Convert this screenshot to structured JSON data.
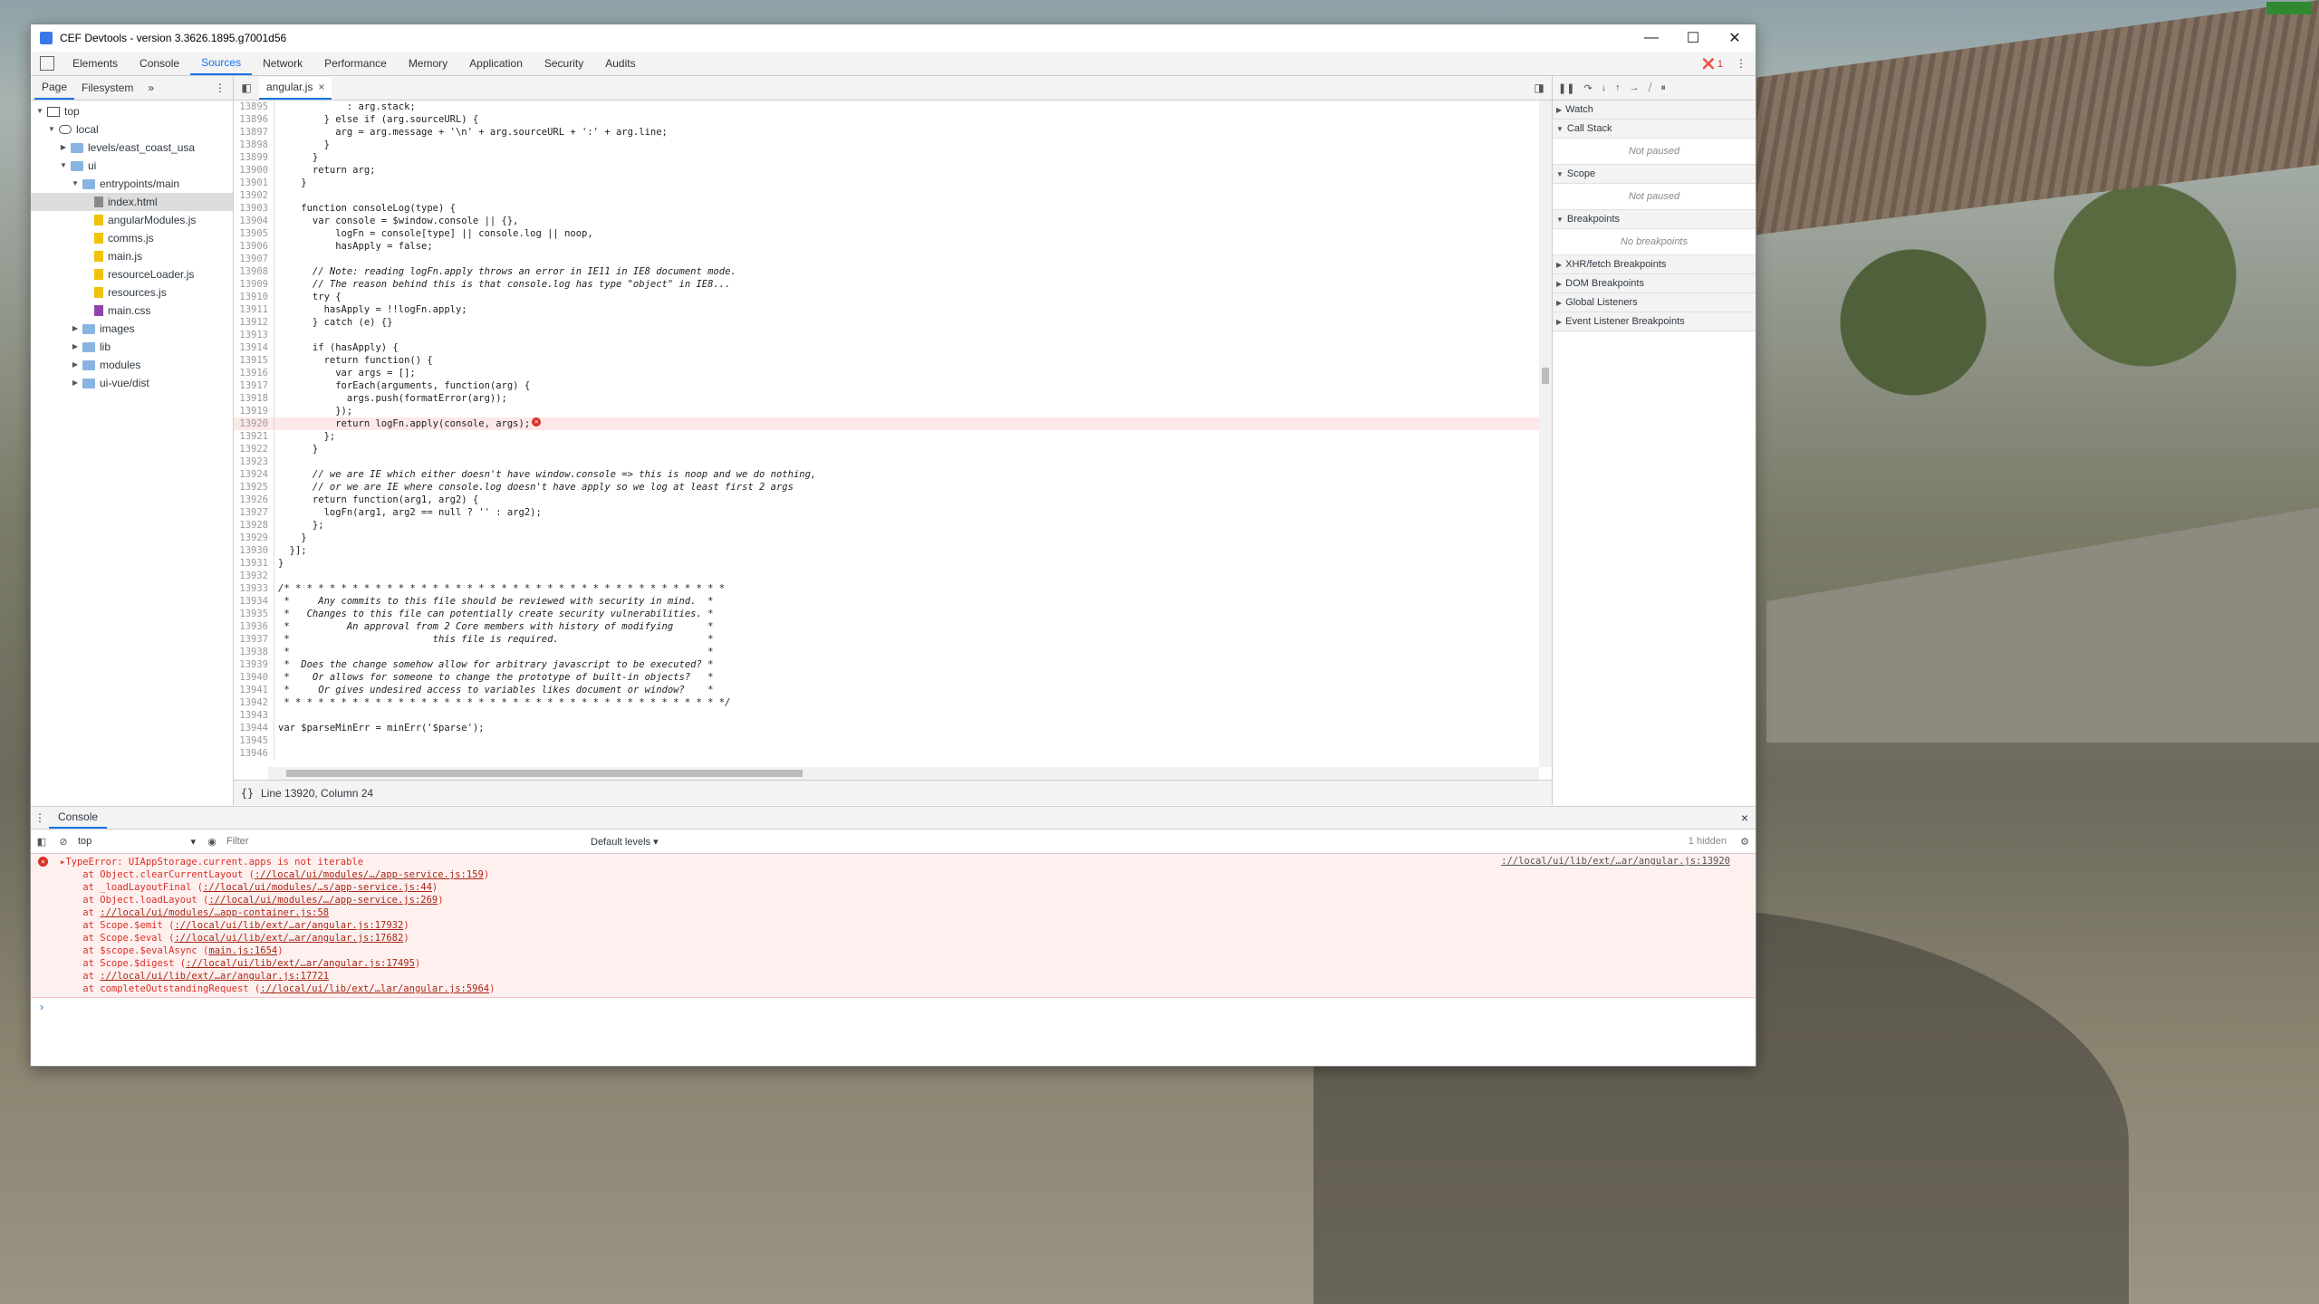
{
  "window": {
    "title": "CEF Devtools - version 3.3626.1895.g7001d56",
    "minimize": "—",
    "maximize": "☐",
    "close": "✕"
  },
  "toolbar": {
    "tabs": [
      "Elements",
      "Console",
      "Sources",
      "Network",
      "Performance",
      "Memory",
      "Application",
      "Security",
      "Audits"
    ],
    "active_tab": "Sources",
    "error_count": "1",
    "error_icon": "❌"
  },
  "navigator": {
    "tabs": [
      "Page",
      "Filesystem"
    ],
    "more": "»",
    "kebab": "⋮",
    "tree": [
      {
        "label": "top",
        "depth": 0,
        "icon": "top",
        "open": true
      },
      {
        "label": "local",
        "depth": 1,
        "icon": "cloud",
        "open": true
      },
      {
        "label": "levels/east_coast_usa",
        "depth": 2,
        "icon": "folder",
        "open": false
      },
      {
        "label": "ui",
        "depth": 2,
        "icon": "folder",
        "open": true
      },
      {
        "label": "entrypoints/main",
        "depth": 3,
        "icon": "folder",
        "open": true
      },
      {
        "label": "index.html",
        "depth": 4,
        "icon": "html",
        "selected": true
      },
      {
        "label": "angularModules.js",
        "depth": 4,
        "icon": "js"
      },
      {
        "label": "comms.js",
        "depth": 4,
        "icon": "js"
      },
      {
        "label": "main.js",
        "depth": 4,
        "icon": "js"
      },
      {
        "label": "resourceLoader.js",
        "depth": 4,
        "icon": "js"
      },
      {
        "label": "resources.js",
        "depth": 4,
        "icon": "js"
      },
      {
        "label": "main.css",
        "depth": 4,
        "icon": "css"
      },
      {
        "label": "images",
        "depth": 3,
        "icon": "folder",
        "open": false
      },
      {
        "label": "lib",
        "depth": 3,
        "icon": "folder",
        "open": false
      },
      {
        "label": "modules",
        "depth": 3,
        "icon": "folder",
        "open": false
      },
      {
        "label": "ui-vue/dist",
        "depth": 3,
        "icon": "folder",
        "open": false
      }
    ]
  },
  "editor": {
    "file_tab": "angular.js",
    "status": "Line 13920, Column 24",
    "lines": [
      {
        "n": "13895",
        "t": "            : arg.stack;"
      },
      {
        "n": "13896",
        "t": "        } else if (arg.sourceURL) {"
      },
      {
        "n": "13897",
        "t": "          arg = arg.message + '\\n' + arg.sourceURL + ':' + arg.line;"
      },
      {
        "n": "13898",
        "t": "        }"
      },
      {
        "n": "13899",
        "t": "      }"
      },
      {
        "n": "13900",
        "t": "      return arg;"
      },
      {
        "n": "13901",
        "t": "    }"
      },
      {
        "n": "13902",
        "t": ""
      },
      {
        "n": "13903",
        "t": "    function consoleLog(type) {"
      },
      {
        "n": "13904",
        "t": "      var console = $window.console || {},"
      },
      {
        "n": "13905",
        "t": "          logFn = console[type] || console.log || noop,"
      },
      {
        "n": "13906",
        "t": "          hasApply = false;"
      },
      {
        "n": "13907",
        "t": ""
      },
      {
        "n": "13908",
        "t": "      // Note: reading logFn.apply throws an error in IE11 in IE8 document mode.",
        "c": 1
      },
      {
        "n": "13909",
        "t": "      // The reason behind this is that console.log has type \"object\" in IE8...",
        "c": 1
      },
      {
        "n": "13910",
        "t": "      try {"
      },
      {
        "n": "13911",
        "t": "        hasApply = !!logFn.apply;"
      },
      {
        "n": "13912",
        "t": "      } catch (e) {}"
      },
      {
        "n": "13913",
        "t": ""
      },
      {
        "n": "13914",
        "t": "      if (hasApply) {"
      },
      {
        "n": "13915",
        "t": "        return function() {"
      },
      {
        "n": "13916",
        "t": "          var args = [];"
      },
      {
        "n": "13917",
        "t": "          forEach(arguments, function(arg) {"
      },
      {
        "n": "13918",
        "t": "            args.push(formatError(arg));"
      },
      {
        "n": "13919",
        "t": "          });"
      },
      {
        "n": "13920",
        "t": "          return logFn.apply(console, args);",
        "e": 1
      },
      {
        "n": "13921",
        "t": "        };"
      },
      {
        "n": "13922",
        "t": "      }"
      },
      {
        "n": "13923",
        "t": ""
      },
      {
        "n": "13924",
        "t": "      // we are IE which either doesn't have window.console => this is noop and we do nothing,",
        "c": 1
      },
      {
        "n": "13925",
        "t": "      // or we are IE where console.log doesn't have apply so we log at least first 2 args",
        "c": 1
      },
      {
        "n": "13926",
        "t": "      return function(arg1, arg2) {"
      },
      {
        "n": "13927",
        "t": "        logFn(arg1, arg2 == null ? '' : arg2);"
      },
      {
        "n": "13928",
        "t": "      };"
      },
      {
        "n": "13929",
        "t": "    }"
      },
      {
        "n": "13930",
        "t": "  }];"
      },
      {
        "n": "13931",
        "t": "}"
      },
      {
        "n": "13932",
        "t": ""
      },
      {
        "n": "13933",
        "t": "/* * * * * * * * * * * * * * * * * * * * * * * * * * * * * * * * * * * * * * *",
        "c": 1
      },
      {
        "n": "13934",
        "t": " *     Any commits to this file should be reviewed with security in mind.  *",
        "c": 1
      },
      {
        "n": "13935",
        "t": " *   Changes to this file can potentially create security vulnerabilities. *",
        "c": 1
      },
      {
        "n": "13936",
        "t": " *          An approval from 2 Core members with history of modifying      *",
        "c": 1
      },
      {
        "n": "13937",
        "t": " *                         this file is required.                          *",
        "c": 1
      },
      {
        "n": "13938",
        "t": " *                                                                         *",
        "c": 1
      },
      {
        "n": "13939",
        "t": " *  Does the change somehow allow for arbitrary javascript to be executed? *",
        "c": 1
      },
      {
        "n": "13940",
        "t": " *    Or allows for someone to change the prototype of built-in objects?   *",
        "c": 1
      },
      {
        "n": "13941",
        "t": " *     Or gives undesired access to variables likes document or window?    *",
        "c": 1
      },
      {
        "n": "13942",
        "t": " * * * * * * * * * * * * * * * * * * * * * * * * * * * * * * * * * * * * * * */",
        "c": 1
      },
      {
        "n": "13943",
        "t": ""
      },
      {
        "n": "13944",
        "t": "var $parseMinErr = minErr('$parse');"
      },
      {
        "n": "13945",
        "t": ""
      },
      {
        "n": "13946",
        "t": ""
      }
    ]
  },
  "debugger": {
    "panes": [
      {
        "title": "Watch",
        "open": false
      },
      {
        "title": "Call Stack",
        "open": true,
        "body": "Not paused"
      },
      {
        "title": "Scope",
        "open": true,
        "body": "Not paused"
      },
      {
        "title": "Breakpoints",
        "open": true,
        "body": "No breakpoints"
      },
      {
        "title": "XHR/fetch Breakpoints",
        "open": false
      },
      {
        "title": "DOM Breakpoints",
        "open": false
      },
      {
        "title": "Global Listeners",
        "open": false
      },
      {
        "title": "Event Listener Breakpoints",
        "open": false
      }
    ]
  },
  "console": {
    "tab": "Console",
    "context": "top",
    "filter_placeholder": "Filter",
    "levels": "Default levels ▾",
    "hidden": "1 hidden",
    "error": {
      "source": "://local/ui/lib/ext/…ar/angular.js:13920",
      "head": "▸TypeError: UIAppStorage.current.apps is not iterable",
      "stack": [
        {
          "pre": "    at Object.clearCurrentLayout (",
          "link": "://local/ui/modules/…/app-service.js:159",
          "post": ")"
        },
        {
          "pre": "    at _loadLayoutFinal (",
          "link": "://local/ui/modules/…s/app-service.js:44",
          "post": ")"
        },
        {
          "pre": "    at Object.loadLayout (",
          "link": "://local/ui/modules/…/app-service.js:269",
          "post": ")"
        },
        {
          "pre": "    at ",
          "link": "://local/ui/modules/…app-container.js:58",
          "post": ""
        },
        {
          "pre": "    at Scope.$emit (",
          "link": "://local/ui/lib/ext/…ar/angular.js:17932",
          "post": ")"
        },
        {
          "pre": "    at Scope.$eval (",
          "link": "://local/ui/lib/ext/…ar/angular.js:17682",
          "post": ")"
        },
        {
          "pre": "    at $scope.$evalAsync (",
          "link": "main.js:1654",
          "post": ")"
        },
        {
          "pre": "    at Scope.$digest (",
          "link": "://local/ui/lib/ext/…ar/angular.js:17495",
          "post": ")"
        },
        {
          "pre": "    at ",
          "link": "://local/ui/lib/ext/…ar/angular.js:17721",
          "post": ""
        },
        {
          "pre": "    at completeOutstandingRequest (",
          "link": "://local/ui/lib/ext/…lar/angular.js:5964",
          "post": ")"
        }
      ]
    },
    "prompt": "›"
  }
}
